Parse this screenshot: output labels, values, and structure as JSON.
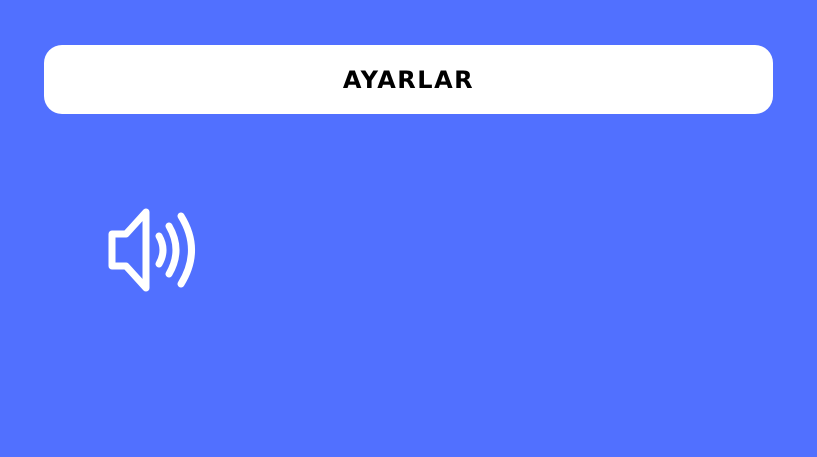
{
  "header": {
    "title": "AYARLAR"
  },
  "controls": {
    "sound_toggle": {
      "icon": "volume-icon",
      "state": "on"
    }
  },
  "colors": {
    "background": "#5170FF",
    "header_background": "#FFFFFF",
    "title_text": "#000000",
    "icon": "#FFFFFF"
  }
}
